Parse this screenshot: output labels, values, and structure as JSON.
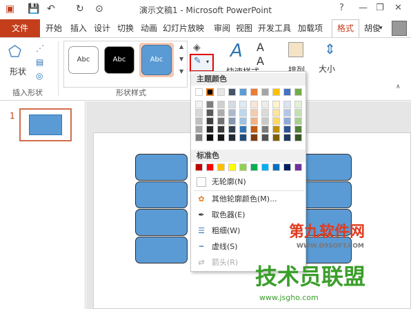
{
  "titlebar": {
    "title": "演示文稿1 - Microsoft PowerPoint",
    "help": "?",
    "minimize": "—",
    "restore": "❐",
    "close": "✕"
  },
  "tabs": {
    "file": "文件",
    "items": [
      "开始",
      "插入",
      "设计",
      "切换",
      "动画",
      "幻灯片放映",
      "审阅",
      "视图",
      "开发工具",
      "加载项"
    ],
    "format": "格式",
    "user": "胡俊"
  },
  "ribbon": {
    "shape_label": "形状",
    "insert_group": "插入形状",
    "style_group": "形状样式",
    "style_thumb": "Abc",
    "quick_styles": "快速样式",
    "arrange": "排列",
    "size": "大小"
  },
  "slide_number": "1",
  "dropdown": {
    "theme_header": "主题颜色",
    "standard_header": "标准色",
    "theme_top": [
      "#ffffff",
      "#000000",
      "#e7e6e6",
      "#44546a",
      "#5b9bd5",
      "#ed7d31",
      "#a5a5a5",
      "#ffc000",
      "#4472c4",
      "#70ad47"
    ],
    "theme_shades": [
      [
        "#f2f2f2",
        "#7f7f7f",
        "#d0cece",
        "#d6dce4",
        "#deebf6",
        "#fbe5d5",
        "#ededed",
        "#fff2cc",
        "#dae3f3",
        "#e2efd9"
      ],
      [
        "#d8d8d8",
        "#595959",
        "#aeabab",
        "#adb9ca",
        "#bdd7ee",
        "#f7cbac",
        "#dbdbdb",
        "#fee599",
        "#b4c6e7",
        "#c5e0b3"
      ],
      [
        "#bfbfbf",
        "#3f3f3f",
        "#757070",
        "#8496b0",
        "#9cc3e5",
        "#f4b183",
        "#c9c9c9",
        "#ffd965",
        "#8eaadb",
        "#a8d08d"
      ],
      [
        "#a5a5a5",
        "#262626",
        "#3a3838",
        "#323f4f",
        "#2e75b5",
        "#c55a11",
        "#7b7b7b",
        "#bf9000",
        "#2f5496",
        "#538135"
      ],
      [
        "#7f7f7f",
        "#0c0c0c",
        "#171616",
        "#222a35",
        "#1e4e79",
        "#833c0b",
        "#525252",
        "#7f6000",
        "#1f3864",
        "#375623"
      ]
    ],
    "standard": [
      "#c00000",
      "#ff0000",
      "#ffc000",
      "#ffff00",
      "#92d050",
      "#00b050",
      "#00b0f0",
      "#0070c0",
      "#002060",
      "#7030a0"
    ],
    "items": [
      {
        "label": "无轮廓(N)",
        "icon": "blank-icon"
      },
      {
        "label": "其他轮廓颜色(M)...",
        "icon": "palette-icon"
      },
      {
        "label": "取色器(E)",
        "icon": "eyedropper-icon"
      },
      {
        "label": "粗细(W)",
        "icon": "weight-icon"
      },
      {
        "label": "虚线(S)",
        "icon": "dash-icon"
      },
      {
        "label": "箭头(R)",
        "icon": "arrow-icon"
      }
    ]
  },
  "watermarks": {
    "site1": "第九软件网",
    "site1_url": "WWW.D9SOFT.COM",
    "site2": "技术员联盟",
    "site2_url": "www.jsgho.com"
  }
}
